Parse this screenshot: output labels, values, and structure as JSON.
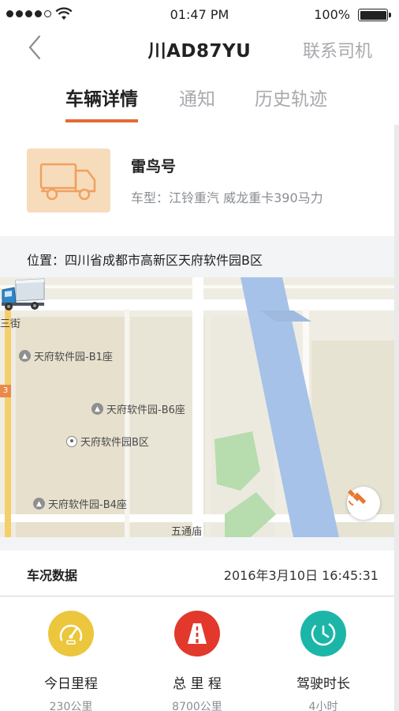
{
  "status_bar": {
    "time": "01:47 PM",
    "battery": "100%",
    "battery_level": 1.0,
    "signal_bars_filled": 4,
    "signal_bars_total": 5
  },
  "nav": {
    "title": "川AD87YU",
    "action": "联系司机",
    "back_icon": "chevron-left-icon"
  },
  "tabs": [
    {
      "label": "车辆详情",
      "active": true
    },
    {
      "label": "通知",
      "active": false
    },
    {
      "label": "历史轨迹",
      "active": false
    }
  ],
  "vehicle": {
    "name": "雷鸟号",
    "type": "车型：江铃重汽 威龙重卡390马力",
    "icon": "truck-icon"
  },
  "location": "位置：四川省成都市高新区天府软件园B区",
  "map": {
    "pois": [
      {
        "label": "天府软件园-B1座",
        "icon": "building-icon"
      },
      {
        "label": "天府软件园-B6座",
        "icon": "building-icon"
      },
      {
        "label": "天府软件园B区",
        "icon": "poi-dot-icon"
      },
      {
        "label": "天府软件园-B4座",
        "icon": "building-icon"
      }
    ],
    "streets": [
      "三街",
      "五通庙"
    ],
    "side_badge": "3"
  },
  "condition": {
    "label": "车况数据",
    "timestamp": "2016年3月10日 16:45:31"
  },
  "stats": [
    {
      "label": "今日里程",
      "value": "230公里",
      "icon": "speedometer-icon",
      "color": "#ecc63c"
    },
    {
      "label": "总 里 程",
      "value": "8700公里",
      "icon": "road-icon",
      "color": "#e2392c"
    },
    {
      "label": "驾驶时长",
      "value": "4小时",
      "icon": "clock-icon",
      "color": "#1cb6a8"
    }
  ],
  "colors": {
    "accent": "#e46b35",
    "muted": "#a7a9ad"
  }
}
